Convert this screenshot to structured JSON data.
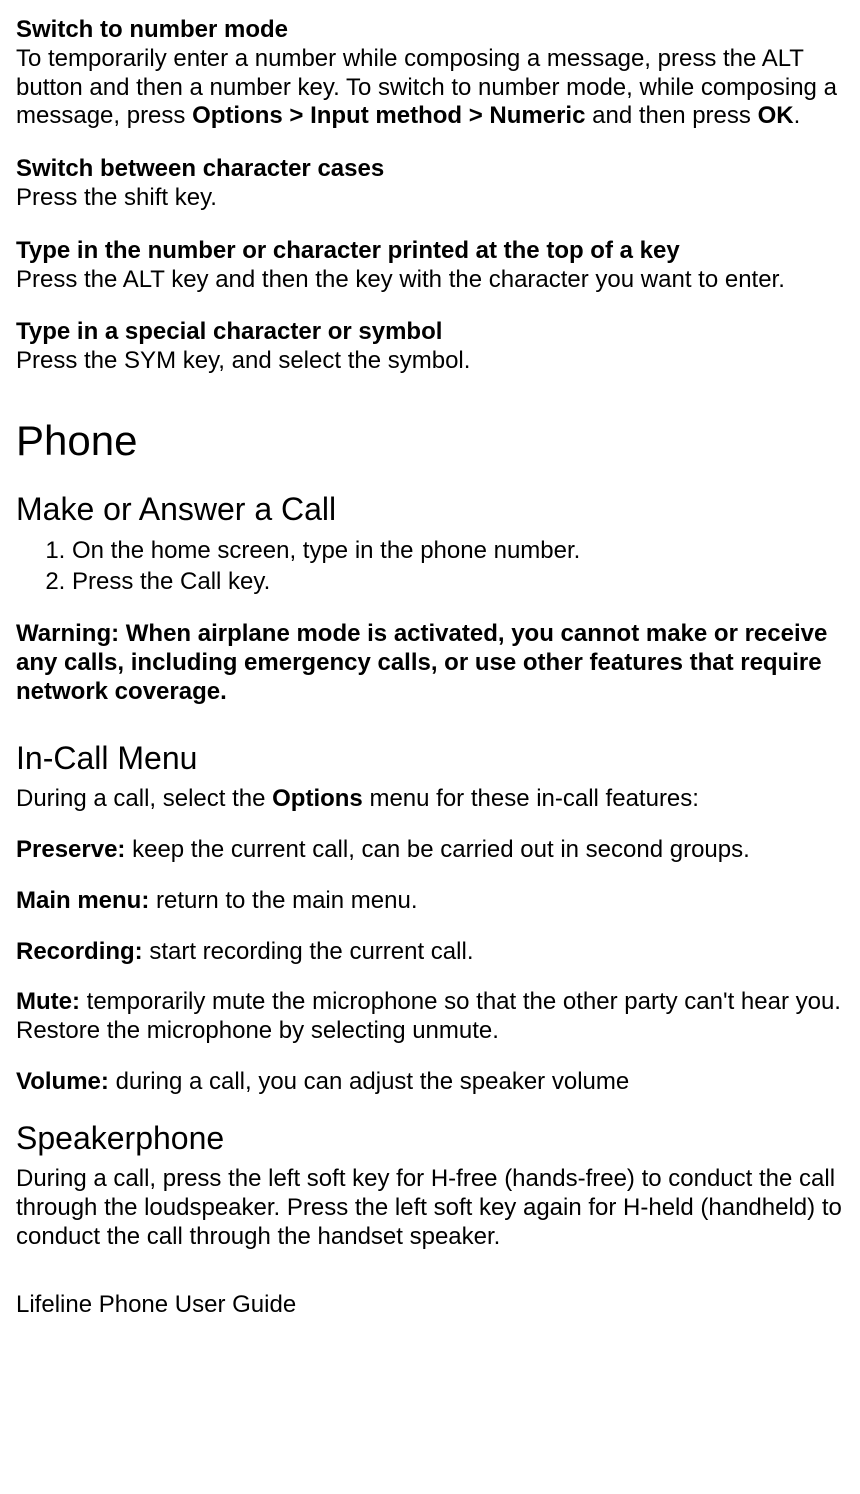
{
  "s1": {
    "heading": "Switch to number mode",
    "body_a": "To temporarily enter a number while composing a message, press the ALT button and then a number key.  To switch to number mode, while composing a message, press ",
    "body_bold": "Options > Input method > Numeric",
    "body_b": " and then press ",
    "body_bold2": "OK",
    "body_c": "."
  },
  "s2": {
    "heading": "Switch between character cases",
    "body": "Press the shift key."
  },
  "s3": {
    "heading": "Type in the number or character printed at the top of a key",
    "body": "Press the ALT key and then the key with the character you want to enter."
  },
  "s4": {
    "heading": "Type in a special character or symbol",
    "body": "Press the SYM key, and select the symbol."
  },
  "phone": {
    "title": "Phone",
    "make_answer": {
      "heading": "Make or Answer a Call",
      "step1": "On the home screen, type in the phone number.",
      "step2": "Press the Call key."
    },
    "warning": "Warning: When airplane mode is activated, you cannot make or receive any calls, including emergency calls, or use other features that require network coverage.",
    "incall": {
      "heading": "In-Call Menu",
      "intro_a": "During a call, select the ",
      "intro_bold": "Options",
      "intro_b": " menu for these in-call features:",
      "preserve_label": "Preserve:",
      "preserve_text": " keep the current call, can be carried out in second groups.",
      "mainmenu_label": "Main menu:",
      "mainmenu_text": " return to the main menu.",
      "recording_label": "Recording:",
      "recording_text": " start recording the current call.",
      "mute_label": "Mute:",
      "mute_text": " temporarily mute the microphone so that the other party can't hear you. Restore the microphone by selecting unmute.",
      "volume_label": "Volume:",
      "volume_text": " during a call, you can adjust the speaker volume"
    },
    "speakerphone": {
      "heading": "Speakerphone",
      "body": "During a call, press the left soft key for H-free (hands-free) to conduct the call through the loudspeaker. Press the left soft key again for H-held (handheld) to conduct the call through the handset speaker."
    }
  },
  "footer": "Lifeline Phone User Guide"
}
